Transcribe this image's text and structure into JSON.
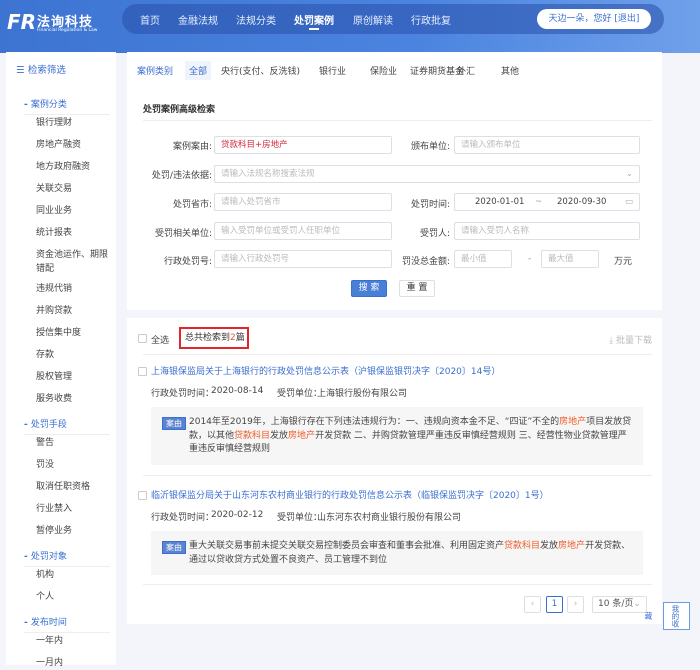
{
  "header": {
    "logo_mark": "FR",
    "logo_cn": "法询科技",
    "logo_en": "Financial Regulation & Law",
    "nav": [
      "首页",
      "金融法规",
      "法规分类",
      "处罚案例",
      "原创解读",
      "行政批复"
    ],
    "active_nav": "处罚案例",
    "user": "天边一朵，您好 [退出]"
  },
  "sidebar": {
    "title": "检索筛选",
    "sections": [
      {
        "title": "案例分类",
        "items": [
          "银行理财",
          "房地产融资",
          "地方政府融资",
          "关联交易",
          "同业业务",
          "统计报表",
          "资金池运作、期限错配",
          "违规代销",
          "并购贷款",
          "授信集中度",
          "存款",
          "股权管理",
          "服务收费"
        ]
      },
      {
        "title": "处罚手段",
        "items": [
          "警告",
          "罚没",
          "取消任职资格",
          "行业禁入",
          "暂停业务"
        ]
      },
      {
        "title": "处罚对象",
        "items": [
          "机构",
          "个人"
        ]
      },
      {
        "title": "发布时间",
        "items": [
          "一年内",
          "一月内"
        ]
      }
    ]
  },
  "tabs": {
    "label": "案例类别",
    "items": [
      "全部",
      "央行(支付、反洗钱)",
      "银行业",
      "保险业",
      "证券期货基金",
      "外汇",
      "其他"
    ]
  },
  "form": {
    "title": "处罚案例高级检索",
    "case_reason_label": "案例案由:",
    "case_reason_value": "贷款科目+房地产",
    "issuer_label": "颁布单位:",
    "issuer_placeholder": "请输入颁布单位",
    "basis_label": "处罚/违法依据:",
    "basis_placeholder": "请输入法规名称搜索法规",
    "province_label": "处罚省市:",
    "province_placeholder": "请输入处罚省市",
    "time_label": "处罚时间:",
    "date_from": "2020-01-01",
    "date_sep": "~",
    "date_to": "2020-09-30",
    "unit_label": "受罚相关单位:",
    "unit_placeholder": "输入受罚单位或受罚人任职单位",
    "person_label": "受罚人:",
    "person_placeholder": "请输入受罚人名称",
    "number_label": "行政处罚号:",
    "number_placeholder": "请输入行政处罚号",
    "amount_label": "罚没总金额:",
    "min_placeholder": "最小值",
    "amount_sep": "-",
    "max_placeholder": "最大值",
    "amount_unit": "万元",
    "search_button": "搜 索",
    "reset_button": "重 置"
  },
  "results": {
    "select_all": "全选",
    "count_prefix": "总共检索到",
    "count": "2",
    "count_suffix": "篇",
    "batch_download": "批量下载",
    "items": [
      {
        "title": "上海银保监局关于上海银行的行政处罚信息公示表（沪银保监银罚决字〔2020〕14号）",
        "time_label": "行政处罚时间：",
        "time": "2020-08-14",
        "unit_label": "受罚单位：",
        "unit": "上海银行股份有限公司",
        "tag": "案由",
        "summary": [
          {
            "t": "2014年至2019年，上海银行存在下列违法违规行为：一、违规向资本金不足、“四证”不全的"
          },
          {
            "t": "房地产",
            "h": 1
          },
          {
            "t": "项目发放贷款，以其他"
          },
          {
            "t": "贷款科目",
            "h": 1
          },
          {
            "t": "发放"
          },
          {
            "t": "房地产",
            "h": 1
          },
          {
            "t": "开发贷款 二、并购贷款管理严重违反审慎经营规则 三、经营性物业贷款管理严重违反审慎经营规则"
          }
        ]
      },
      {
        "title": "临沂银保监分局关于山东河东农村商业银行的行政处罚信息公示表（临银保监罚决字〔2020〕1号）",
        "time_label": "行政处罚时间：",
        "time": "2020-02-12",
        "unit_label": "受罚单位：",
        "unit": "山东河东农村商业银行股份有限公司",
        "tag": "案由",
        "summary": [
          {
            "t": "重大关联交易事前未提交关联交易控制委员会审查和董事会批准、利用固定资产"
          },
          {
            "t": "贷款科目",
            "h": 1
          },
          {
            "t": "发放"
          },
          {
            "t": "房地产",
            "h": 1
          },
          {
            "t": "开发贷款、通过以贷收贷方式处置不良资产、员工管理不到位"
          }
        ]
      }
    ]
  },
  "pagination": {
    "current": "1",
    "page_size": "10 条/页"
  },
  "float": {
    "favorites": "我的收藏"
  }
}
